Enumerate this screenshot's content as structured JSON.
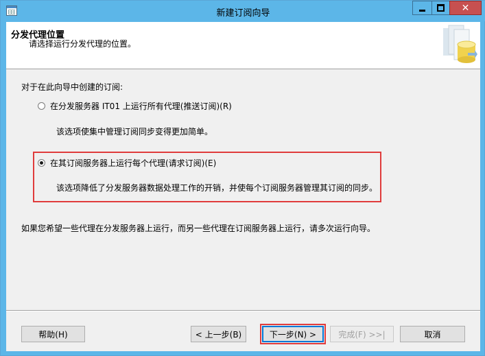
{
  "window": {
    "title": "新建订阅向导"
  },
  "header": {
    "title": "分发代理位置",
    "subtitle": "请选择运行分发代理的位置。"
  },
  "body": {
    "intro": "对于在此向导中创建的订阅:",
    "options": [
      {
        "label": "在分发服务器 IT01 上运行所有代理(推送订阅)(R)",
        "description": "该选项使集中管理订阅同步变得更加简单。",
        "selected": false
      },
      {
        "label": "在其订阅服务器上运行每个代理(请求订阅)(E)",
        "description": "该选项降低了分发服务器数据处理工作的开销，并使每个订阅服务器管理其订阅的同步。",
        "selected": true
      }
    ],
    "note": "如果您希望一些代理在分发服务器上运行，而另一些代理在订阅服务器上运行，请多次运行向导。"
  },
  "footer": {
    "help": "帮助(H)",
    "back": "< 上一步(B)",
    "next": "下一步(N) >",
    "finish": "完成(F) >>|",
    "cancel": "取消"
  },
  "colors": {
    "titlebar": "#5cb6e8",
    "highlight": "#e03b3b",
    "close": "#c75050"
  }
}
